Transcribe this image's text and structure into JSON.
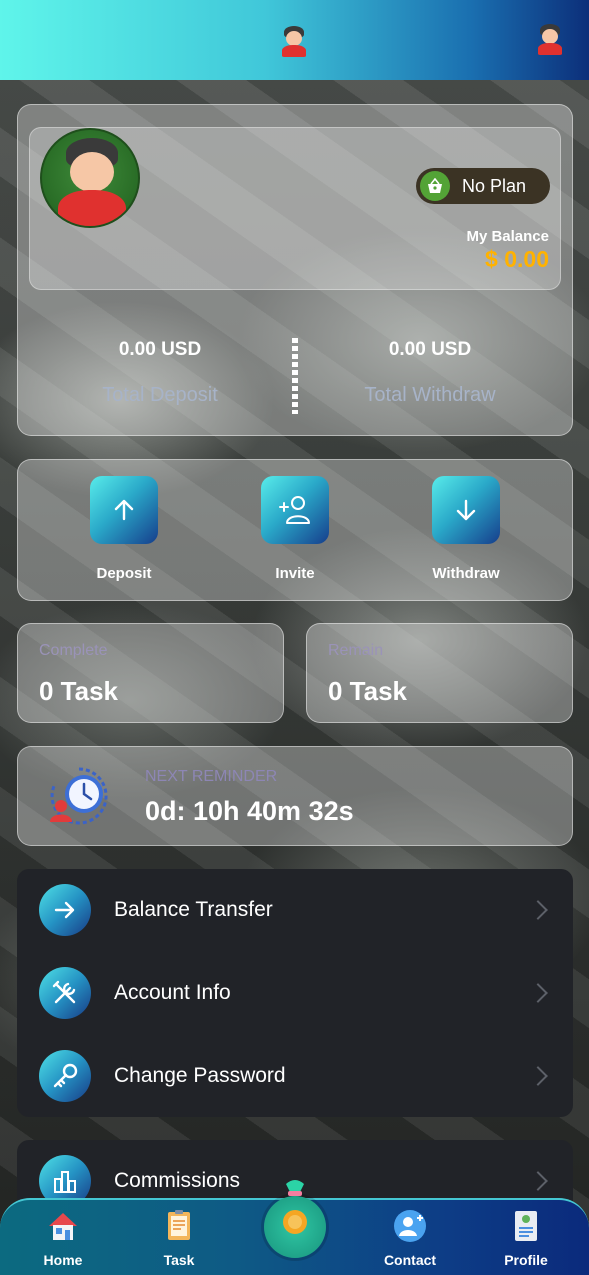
{
  "profile": {
    "plan_label": "No Plan",
    "balance_label": "My Balance",
    "balance_value": "$ 0.00"
  },
  "stats": {
    "deposit_value": "0.00 USD",
    "deposit_label": "Total Deposit",
    "withdraw_value": "0.00 USD",
    "withdraw_label": "Total Withdraw"
  },
  "actions": [
    {
      "label": "Deposit",
      "icon": "arrow-up-icon"
    },
    {
      "label": "Invite",
      "icon": "add-user-icon"
    },
    {
      "label": "Withdraw",
      "icon": "arrow-down-icon"
    }
  ],
  "tasks": {
    "complete_title": "Complete",
    "complete_value": "0 Task",
    "remain_title": "Remain",
    "remain_value": "0 Task"
  },
  "reminder": {
    "title": "NEXT REMINDER",
    "time": "0d: 10h 40m 32s"
  },
  "menu": [
    {
      "label": "Balance Transfer",
      "icon": "arrow-right-icon"
    },
    {
      "label": "Account Info",
      "icon": "tools-icon"
    },
    {
      "label": "Change Password",
      "icon": "key-icon"
    },
    {
      "label": "Commissions",
      "icon": "chart-icon"
    }
  ],
  "nav": [
    {
      "label": "Home",
      "icon": "home-icon"
    },
    {
      "label": "Task",
      "icon": "task-icon"
    },
    {
      "label": "Contact",
      "icon": "contact-icon"
    },
    {
      "label": "Profile",
      "icon": "profile-icon"
    }
  ],
  "colors": {
    "header_start": "#5ff5ea",
    "header_end": "#0c2f7a",
    "balance_accent": "#ffb200",
    "menu_bg": "#212328"
  }
}
